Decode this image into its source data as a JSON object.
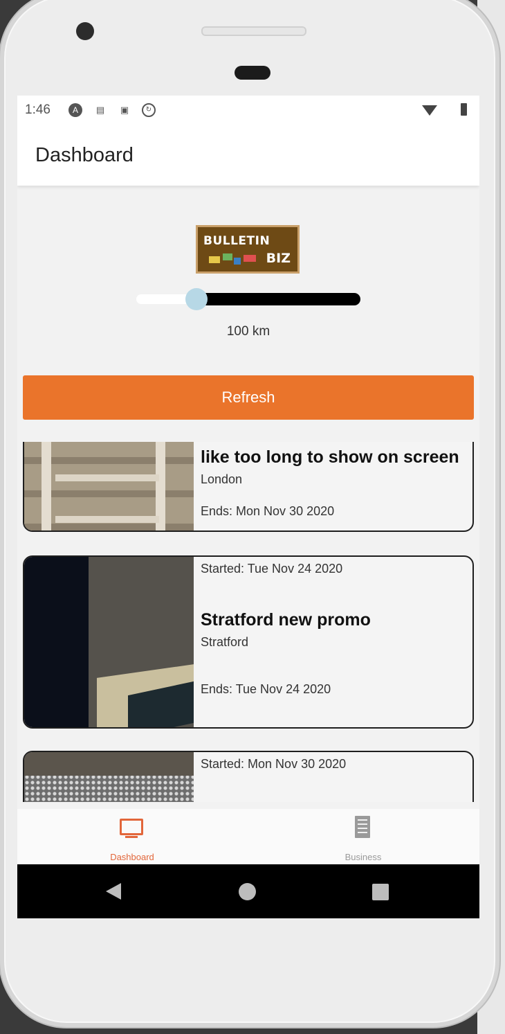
{
  "status_bar": {
    "time": "1:46",
    "icons": [
      "app-icon",
      "notification-icon",
      "notification-icon",
      "sync-icon"
    ],
    "wifi": "wifi-icon",
    "battery": "battery-icon"
  },
  "app_bar": {
    "title": "Dashboard"
  },
  "logo": {
    "line1": "BULLETIN",
    "line2": "BIZ"
  },
  "distance_slider": {
    "value_km": 100,
    "label": "100 km"
  },
  "refresh_button": {
    "label": "Refresh"
  },
  "cards": [
    {
      "title": "like too long to show on screen",
      "location": "London",
      "ends": "Ends: Mon Nov 30 2020"
    },
    {
      "started": "Started: Tue Nov 24 2020",
      "title": "Stratford new promo",
      "location": "Stratford",
      "ends": "Ends: Tue Nov 24 2020"
    },
    {
      "started": "Started: Mon Nov 30 2020"
    }
  ],
  "bottom_nav": {
    "items": [
      {
        "label": "Dashboard",
        "icon": "monitor-icon",
        "active": true
      },
      {
        "label": "Business",
        "icon": "building-icon",
        "active": false
      }
    ]
  },
  "colors": {
    "accent": "#ea742b",
    "active_tab": "#e2663a",
    "inactive_tab": "#9a9a9a"
  }
}
